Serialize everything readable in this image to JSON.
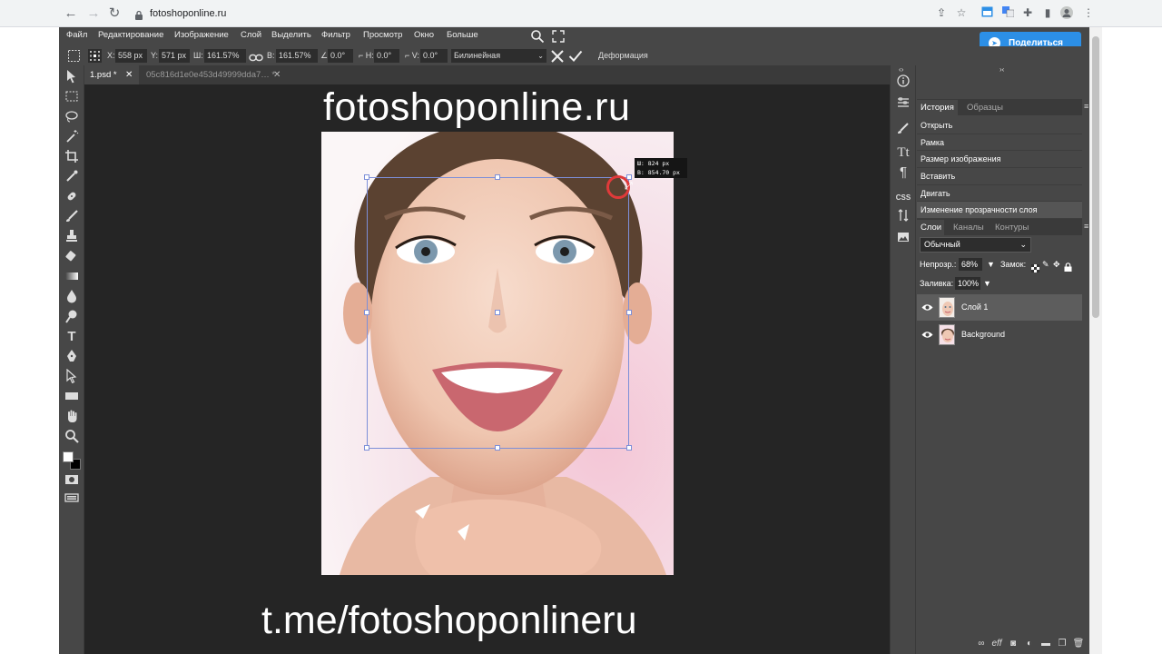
{
  "browser": {
    "url": "fotoshoponline.ru",
    "nav_icons": [
      "back-arrow-icon",
      "forward-arrow-icon",
      "reload-icon",
      "lock-icon"
    ]
  },
  "menu": {
    "items": [
      "Файл",
      "Редактирование",
      "Изображение",
      "Слой",
      "Выделить",
      "Фильтр",
      "Просмотр",
      "Окно",
      "Больше"
    ],
    "share_label": "Поделиться",
    "share_color": "#2c8fe6"
  },
  "options": {
    "x_label": "X:",
    "x_value": "558 px",
    "y_label": "Y:",
    "y_value": "571 px",
    "w_label": "Ш:",
    "w_value": "161.57%",
    "h_label": "В:",
    "h_value": "161.57%",
    "angle_label": "∠:",
    "angle_value": "0.0°",
    "skew_h_label": "⌐ H:",
    "skew_h_value": "0.0°",
    "skew_v_label": "⌐ V:",
    "skew_v_value": "0.0°",
    "interpolation": "Билинейная",
    "deform_label": "Деформация"
  },
  "tabs": [
    {
      "label": "1.psd *",
      "active": true
    },
    {
      "label": "05c816d1e0e453d49999dda7… *",
      "active": false
    }
  ],
  "canvas": {
    "watermark_top": "fotoshoponline.ru",
    "watermark_bottom": "t.me/fotoshoponlineru",
    "size_tip_w": "Ш:   824 px",
    "size_tip_h": "В: 854.70 px"
  },
  "panels": {
    "history_tab": "История",
    "samples_tab": "Образцы",
    "history_items": [
      "Открыть",
      "Рамка",
      "Размер изображения",
      "Вставить",
      "Двигать",
      "Изменение прозрачности слоя"
    ],
    "layers_tab": "Слои",
    "channels_tab": "Каналы",
    "paths_tab": "Контуры",
    "blend_mode": "Обычный",
    "opacity_label": "Непрозр.:",
    "opacity_value": "68%",
    "lock_label": "Замок:",
    "fill_label": "Заливка:",
    "fill_value": "100%",
    "layers": [
      {
        "name": "Слой 1",
        "selected": true
      },
      {
        "name": "Background",
        "selected": false
      }
    ]
  },
  "side_icons": [
    "info-icon",
    "properties-icon",
    "brush-settings-icon",
    "character-icon",
    "paragraph-icon",
    "css-icon",
    "adjust-icon",
    "image-icon"
  ],
  "side_css_label": "CSS",
  "colors": {
    "app_bg": "#474747",
    "canvas_bg": "#252525",
    "bounding_box": "#7d8fd8",
    "cursor_ring": "#e03a3a"
  }
}
